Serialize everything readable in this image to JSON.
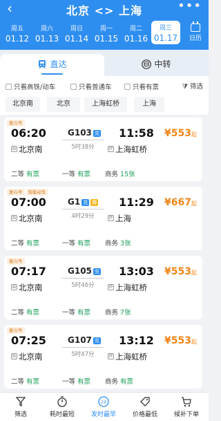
{
  "header": {
    "back_icon": "chevron-left-icon",
    "title": "北京 <> 上海",
    "more_icon": "more-dots-icon"
  },
  "dates": [
    {
      "weekday": "周五",
      "date": "01.12"
    },
    {
      "weekday": "周六",
      "date": "01.13"
    },
    {
      "weekday": "周日",
      "date": "01.14"
    },
    {
      "weekday": "周一",
      "date": "01.15"
    },
    {
      "weekday": "周二",
      "date": "01.16"
    },
    {
      "weekday": "周三",
      "date": "01.17"
    }
  ],
  "calendar_label": "日历",
  "tabs": {
    "direct": "直达",
    "transfer": "中转"
  },
  "filters": {
    "high_speed": "只看高铁/动车",
    "normal": "只看普通车",
    "available": "只看有票",
    "filter": "筛选"
  },
  "stations": [
    "北京南",
    "北京",
    "上海虹桥",
    "上海"
  ],
  "trains": [
    {
      "tags": [
        "复兴号"
      ],
      "dep_time": "06:20",
      "train_no": "G103",
      "badge": "兑",
      "duration": "5时38分",
      "arr_time": "11:58",
      "from_mark": "始",
      "from": "北京南",
      "to_mark": "终",
      "to": "上海虹桥",
      "price": "¥553",
      "price_suffix": "起",
      "seats": [
        {
          "class": "二等",
          "status": "有票"
        },
        {
          "class": "一等",
          "status": "有票"
        },
        {
          "class": "商务",
          "status": "15张"
        }
      ]
    },
    {
      "tags": [
        "复兴号",
        "智能动车"
      ],
      "dep_time": "07:00",
      "train_no": "G1",
      "badge": "兑",
      "badge2": "静",
      "duration": "4时29分",
      "arr_time": "11:29",
      "from_mark": "始",
      "from": "北京南",
      "to_mark": "终",
      "to": "上海",
      "price": "¥667",
      "price_suffix": "起",
      "seats": [
        {
          "class": "二等",
          "status": "有票"
        },
        {
          "class": "一等",
          "status": "有票"
        },
        {
          "class": "商务",
          "status": "3张"
        }
      ]
    },
    {
      "tags": [
        "复兴号"
      ],
      "dep_time": "07:17",
      "train_no": "G105",
      "badge": "兑",
      "duration": "5时46分",
      "arr_time": "13:03",
      "from_mark": "始",
      "from": "北京南",
      "to_mark": "终",
      "to": "上海虹桥",
      "price": "¥553",
      "price_suffix": "起",
      "seats": [
        {
          "class": "二等",
          "status": "有票"
        },
        {
          "class": "一等",
          "status": "有票"
        },
        {
          "class": "商务",
          "status": "7张"
        }
      ]
    },
    {
      "tags": [
        "复兴号"
      ],
      "dep_time": "07:25",
      "train_no": "G107",
      "badge": "兑",
      "duration": "5时47分",
      "arr_time": "13:12",
      "from_mark": "始",
      "from": "北京南",
      "to_mark": "终",
      "to": "上海虹桥",
      "price": "¥553",
      "price_suffix": "起",
      "seats": [
        {
          "class": "二等",
          "status": "有票"
        },
        {
          "class": "一等",
          "status": "有票"
        },
        {
          "class": "商务",
          "status": "有票"
        }
      ]
    }
  ],
  "bottom_nav": [
    {
      "label": "筛选",
      "icon": "funnel-icon"
    },
    {
      "label": "耗时最短",
      "icon": "stopwatch-icon"
    },
    {
      "label": "发时最早",
      "icon": "clock-24-icon"
    },
    {
      "label": "价格最低",
      "icon": "price-tag-icon"
    },
    {
      "label": "候补下单",
      "icon": "cart-icon"
    }
  ],
  "colors": {
    "brand": "#2e8ef0",
    "price": "#f08518",
    "available": "#1ca05a"
  }
}
